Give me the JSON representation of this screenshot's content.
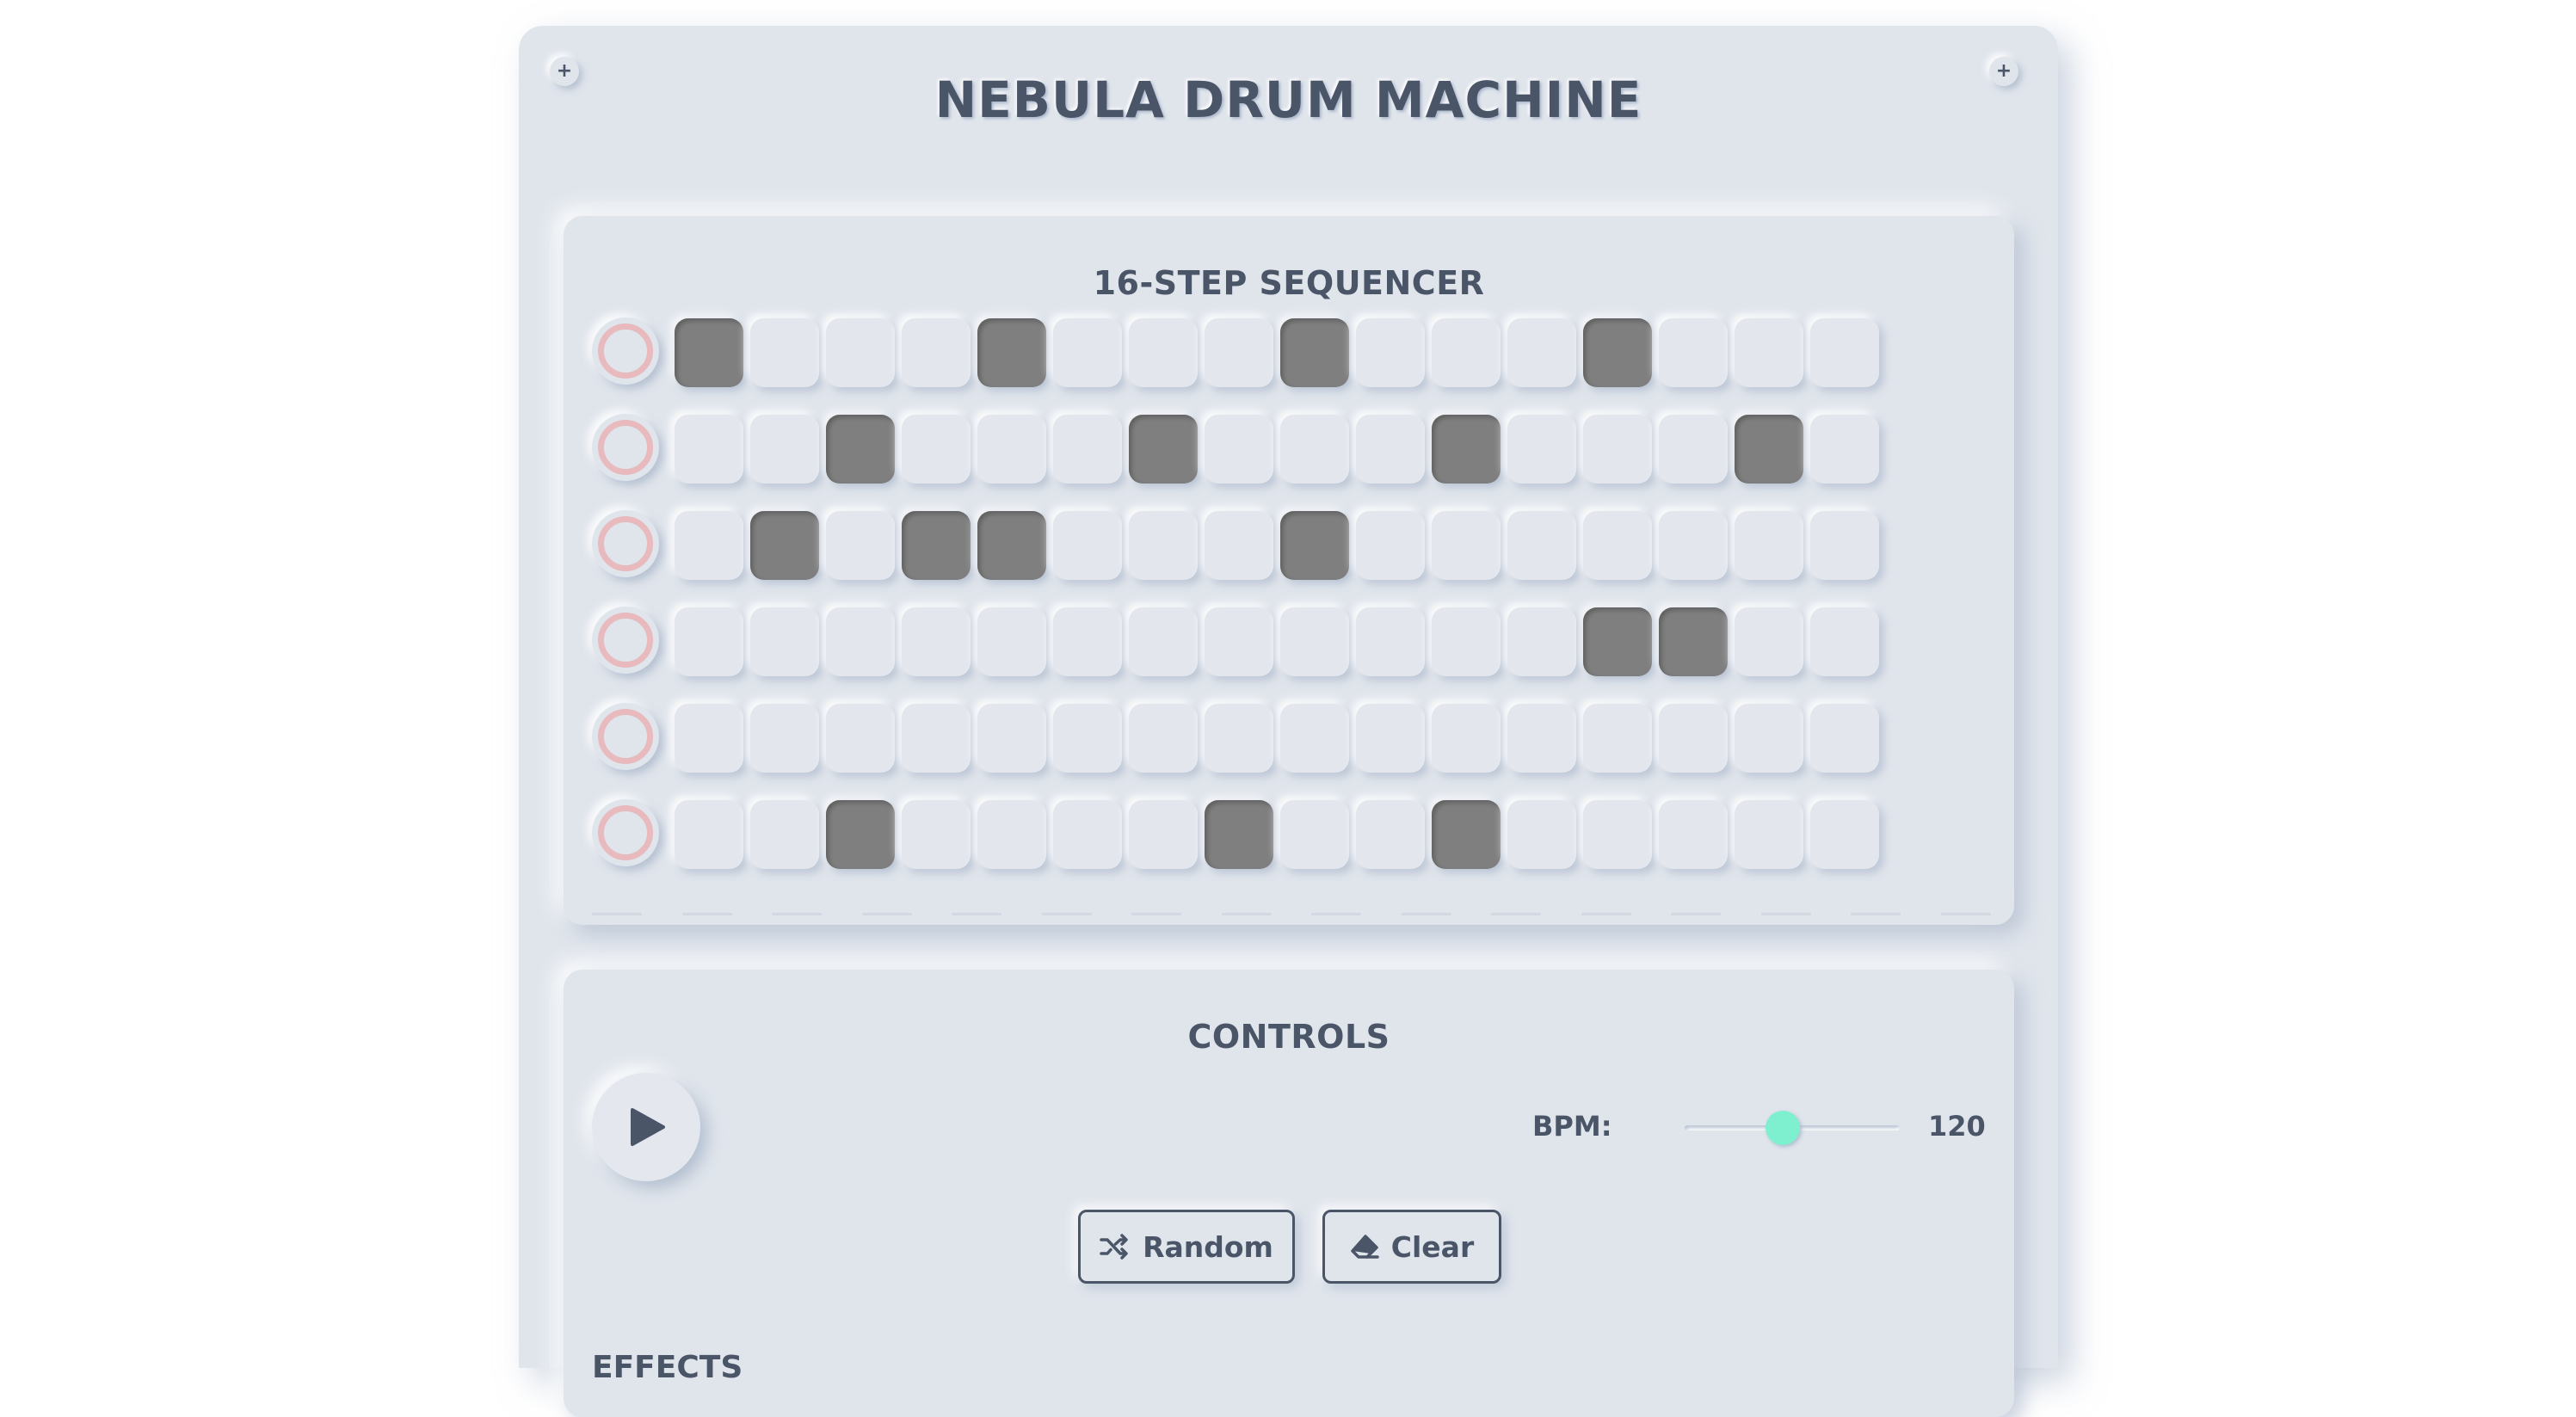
{
  "app": {
    "title": "NEBULA DRUM MACHINE"
  },
  "sequencer": {
    "title": "16-STEP SEQUENCER",
    "tracks": [
      [
        1,
        0,
        0,
        0,
        1,
        0,
        0,
        0,
        1,
        0,
        0,
        0,
        1,
        0,
        0,
        0
      ],
      [
        0,
        0,
        1,
        0,
        0,
        0,
        1,
        0,
        0,
        0,
        1,
        0,
        0,
        0,
        1,
        0
      ],
      [
        0,
        1,
        0,
        1,
        1,
        0,
        0,
        0,
        1,
        0,
        0,
        0,
        0,
        0,
        0,
        0
      ],
      [
        0,
        0,
        0,
        0,
        0,
        0,
        0,
        0,
        0,
        0,
        0,
        0,
        1,
        1,
        0,
        0
      ],
      [
        0,
        0,
        0,
        0,
        0,
        0,
        0,
        0,
        0,
        0,
        0,
        0,
        0,
        0,
        0,
        0
      ],
      [
        0,
        0,
        1,
        0,
        0,
        0,
        0,
        1,
        0,
        0,
        1,
        0,
        0,
        0,
        0,
        0
      ]
    ]
  },
  "controls": {
    "title": "CONTROLS",
    "bpm_label": "BPM:",
    "bpm_value": "120",
    "bpm_min": 60,
    "bpm_max": 180,
    "random_label": "Random",
    "clear_label": "Clear"
  },
  "effects": {
    "title": "EFFECTS"
  },
  "colors": {
    "background": "#e0e5ec",
    "text": "#4a5568",
    "step_active": "#7f7f7f",
    "accent": "#7ef0cf",
    "track_ring": "#e8b9bd"
  },
  "icons": {
    "play": "play-icon",
    "random": "shuffle-icon",
    "clear": "eraser-icon",
    "screws": "plus-icon"
  }
}
